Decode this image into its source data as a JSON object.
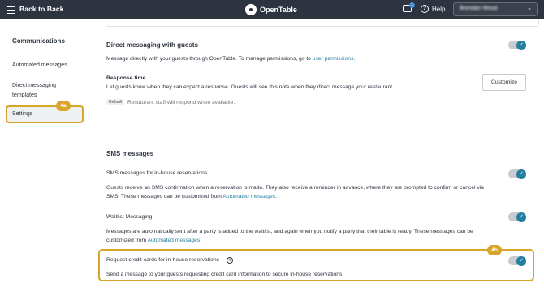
{
  "topbar": {
    "back_label": "Back to Back",
    "logo_text": "OpenTable",
    "messages_badge": "1",
    "help_label": "Help",
    "user_name": "Brendan Wood",
    "colors": {
      "bar": "#2d333f",
      "badge": "#3f8fd6"
    }
  },
  "sidebar": {
    "title": "Communications",
    "items": [
      {
        "label": "Automated messages"
      },
      {
        "label": "Direct messaging templates"
      },
      {
        "label": "Settings",
        "selected": true
      }
    ],
    "annotation": "4a"
  },
  "direct_messaging": {
    "title": "Direct messaging with guests",
    "description": "Message directly with your guests through OpenTable. To manage permissions, go to",
    "link": "user permissions",
    "link_suffix": ".",
    "toggle_on": true,
    "response_time": {
      "label": "Response time",
      "description": "Let guests know when they can expect a response. Guests will see this note when they direct message your restaurant.",
      "customize_label": "Customize",
      "default_tag": "Default",
      "default_text": "Restaurant staff will respond when available."
    }
  },
  "sms": {
    "title": "SMS messages",
    "inhouse": {
      "label": "SMS messages for in-house reservations",
      "description_1": "Guests receive an SMS confirmation when a reservation is made. They also receive a reminder in advance, where they are prompted to confirm or cancel via",
      "description_2": "SMS. These messages can be customized from",
      "link": "Automated messages",
      "suffix": ".",
      "toggle_on": true
    },
    "waitlist": {
      "label": "Waitlist Messaging",
      "description_1": "Messages are automatically sent after a party is added to the waitlist, and again when you notify a party that their table is ready. These messages can be",
      "description_2": "customized from",
      "link": "Automated messages",
      "suffix": ".",
      "toggle_on": true
    },
    "credit_cards": {
      "label": "Request credit cards for in-house reservations",
      "description": "Send a message to your guests requesting credit card information to secure in-house reservations.",
      "toggle_on": true,
      "annotation": "4b"
    }
  },
  "colors": {
    "accent": "#247f9e",
    "highlight": "#d6a52a"
  }
}
